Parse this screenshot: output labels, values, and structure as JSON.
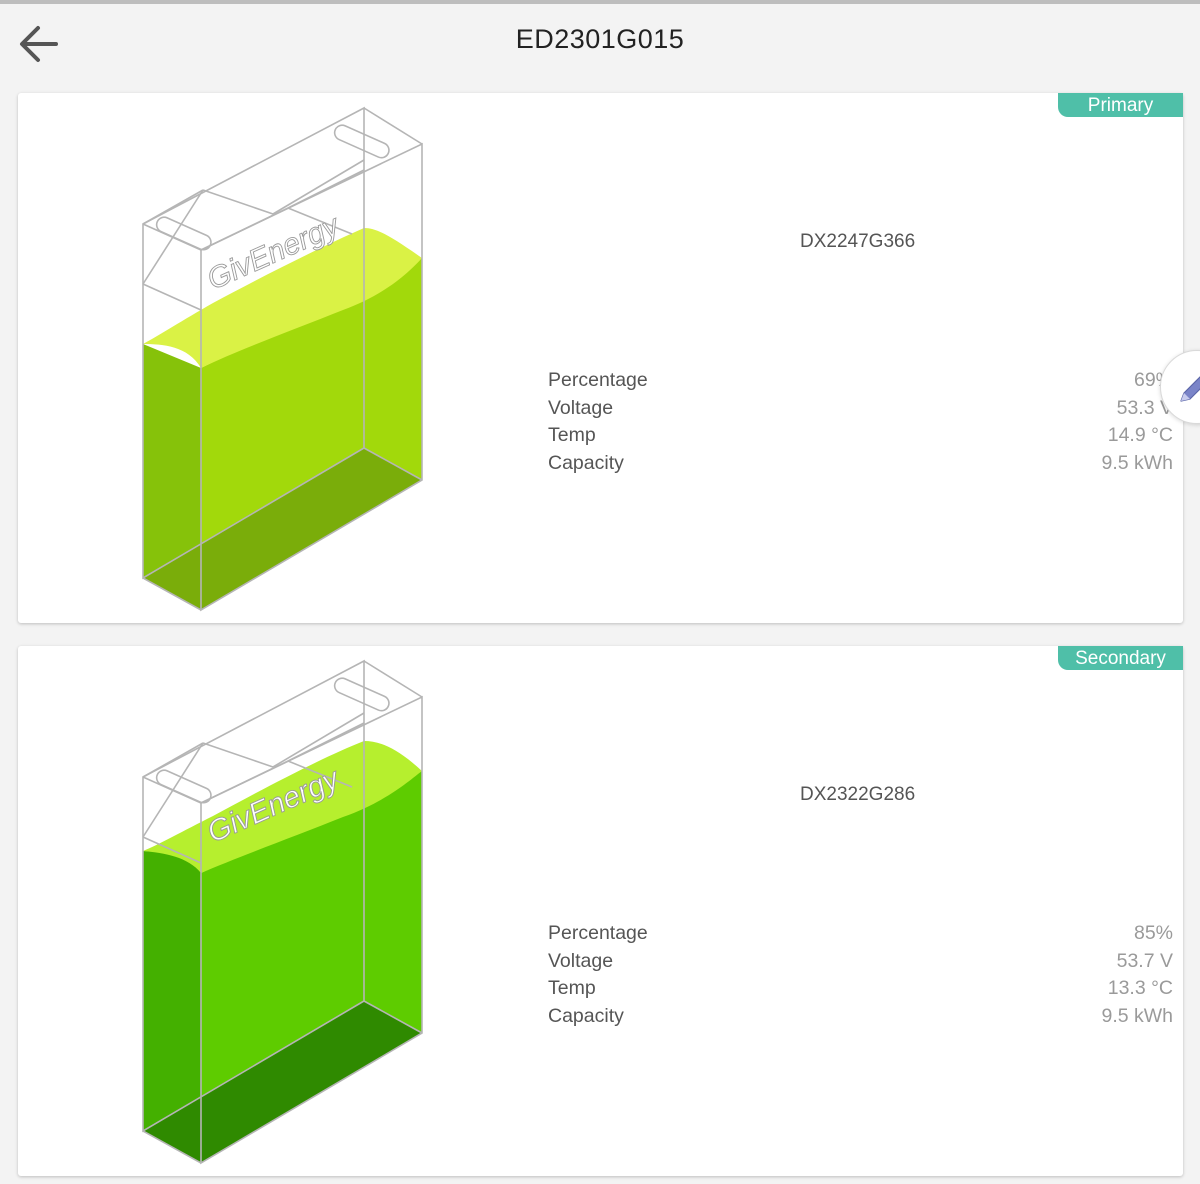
{
  "header": {
    "title": "ED2301G015",
    "back_icon": "arrow-left-icon"
  },
  "colors": {
    "badge": "#4fbfa8",
    "primary_fill": "#a2d90b",
    "primary_fill_top": "#daf245",
    "secondary_fill": "#5ecc00",
    "secondary_fill_top": "#b6ef2e"
  },
  "batteries": [
    {
      "badge": "Primary",
      "brand": "GivEnergy",
      "serial": "DX2247G366",
      "charge_percent": 69,
      "stats": [
        {
          "label": "Percentage",
          "value": "69%"
        },
        {
          "label": "Voltage",
          "value": "53.3 V"
        },
        {
          "label": "Temp",
          "value": "14.9 °C"
        },
        {
          "label": "Capacity",
          "value": "9.5 kWh"
        }
      ]
    },
    {
      "badge": "Secondary",
      "brand": "GivEnergy",
      "serial": "DX2322G286",
      "charge_percent": 85,
      "stats": [
        {
          "label": "Percentage",
          "value": "85%"
        },
        {
          "label": "Voltage",
          "value": "53.7 V"
        },
        {
          "label": "Temp",
          "value": "13.3 °C"
        },
        {
          "label": "Capacity",
          "value": "9.5 kWh"
        }
      ]
    }
  ],
  "edit_icon": "pencil-icon"
}
